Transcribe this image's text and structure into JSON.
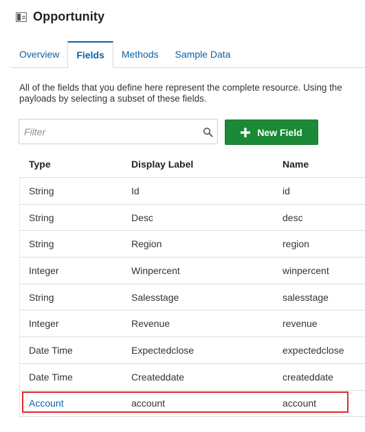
{
  "header": {
    "title": "Opportunity",
    "icon": "resource-icon"
  },
  "tabs": [
    {
      "label": "Overview",
      "active": false
    },
    {
      "label": "Fields",
      "active": true
    },
    {
      "label": "Methods",
      "active": false
    },
    {
      "label": "Sample Data",
      "active": false
    }
  ],
  "description": {
    "line1": "All of the fields that you define here represent the complete resource. Using the",
    "line2": "payloads by selecting a subset of these fields."
  },
  "filter": {
    "placeholder": "Filter",
    "value": ""
  },
  "new_field_button": {
    "label": "New Field"
  },
  "table": {
    "columns": [
      "Type",
      "Display Label",
      "Name"
    ],
    "rows": [
      {
        "type": "String",
        "label": "Id",
        "name": "id"
      },
      {
        "type": "String",
        "label": "Desc",
        "name": "desc"
      },
      {
        "type": "String",
        "label": "Region",
        "name": "region"
      },
      {
        "type": "Integer",
        "label": "Winpercent",
        "name": "winpercent"
      },
      {
        "type": "String",
        "label": "Salesstage",
        "name": "salesstage"
      },
      {
        "type": "Integer",
        "label": "Revenue",
        "name": "revenue"
      },
      {
        "type": "Date Time",
        "label": "Expectedclose",
        "name": "expectedclose"
      },
      {
        "type": "Date Time",
        "label": "Createddate",
        "name": "createddate"
      },
      {
        "type": "Account",
        "label": "account",
        "name": "account"
      }
    ]
  },
  "colors": {
    "accent": "#0b61a4",
    "button_green": "#1a8a36",
    "highlight_red": "#e3262b"
  }
}
